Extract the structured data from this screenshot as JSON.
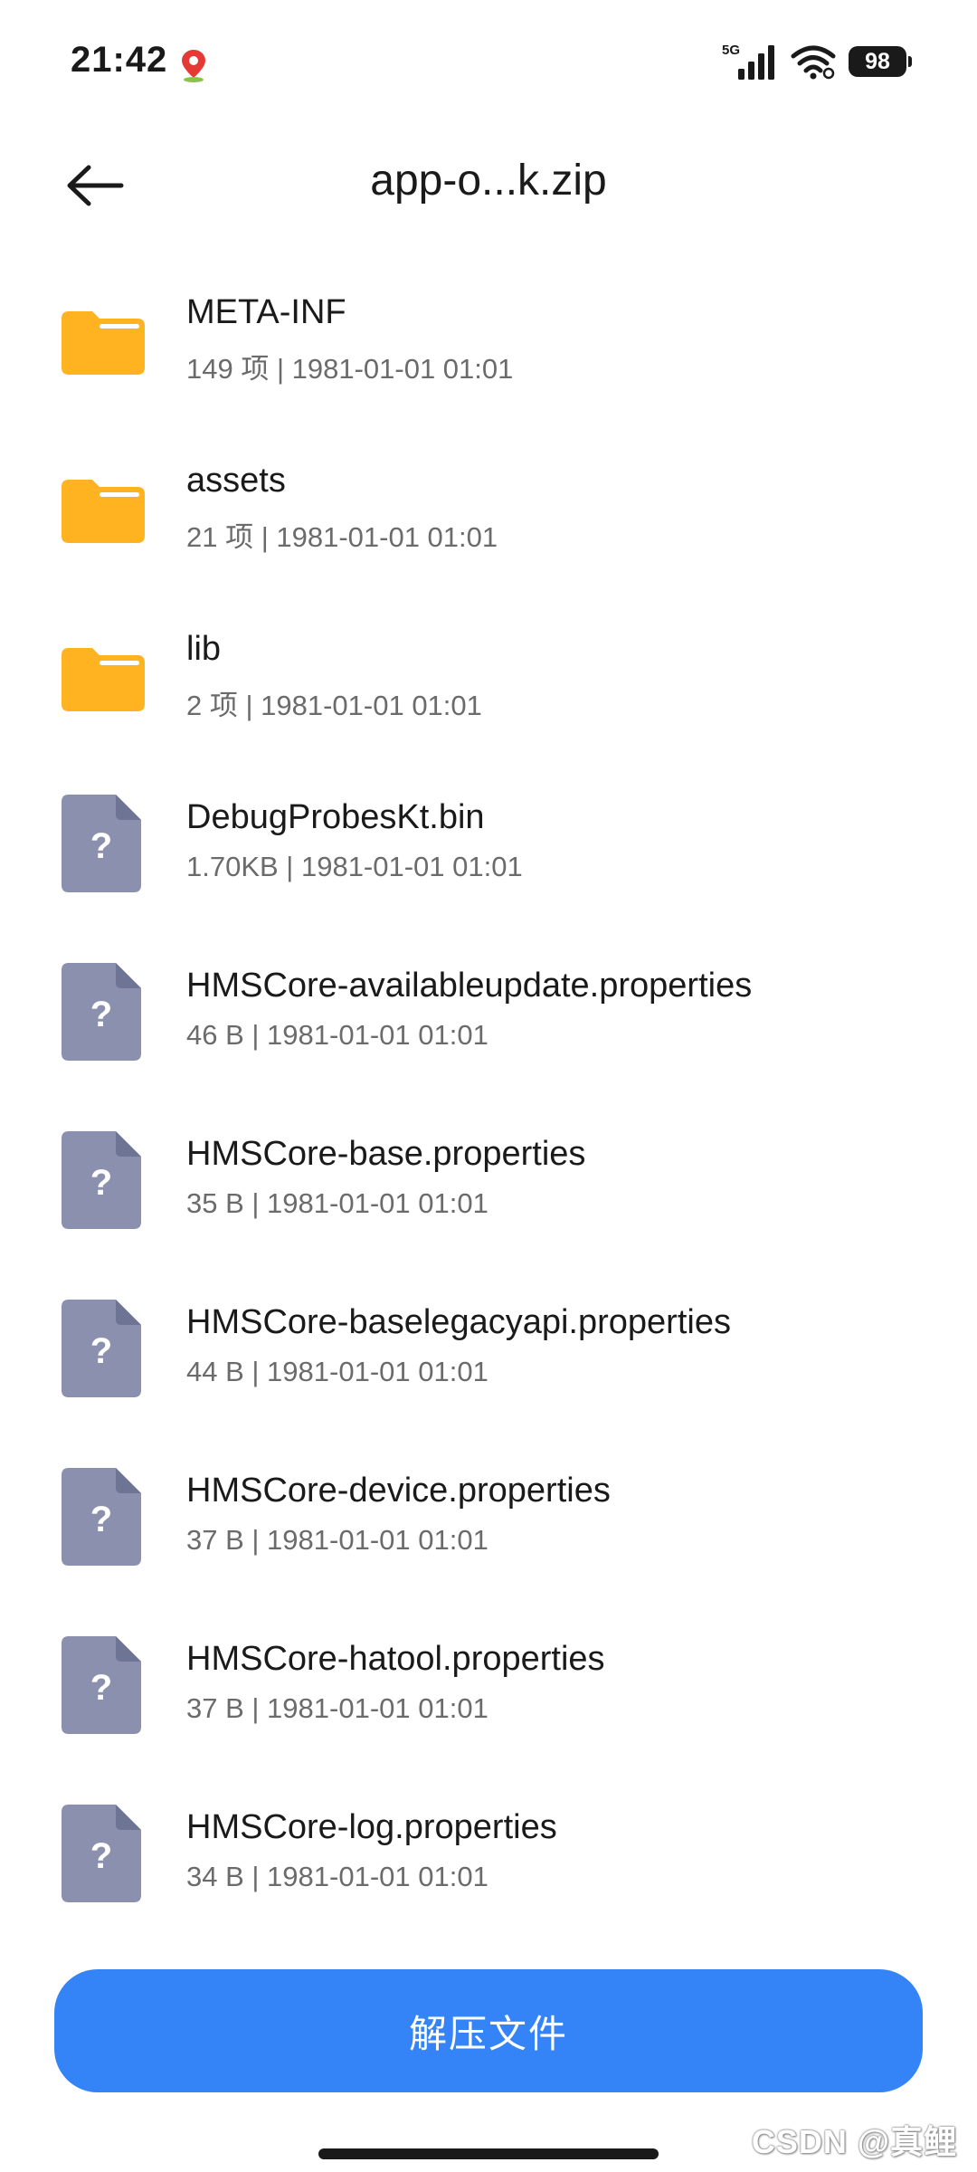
{
  "status_bar": {
    "time": "21:42",
    "network": "5G",
    "battery": "98"
  },
  "header": {
    "title": "app-o...k.zip"
  },
  "files": [
    {
      "name": "META-INF",
      "meta": "149 项 | 1981-01-01 01:01",
      "type": "folder"
    },
    {
      "name": "assets",
      "meta": "21 项 | 1981-01-01 01:01",
      "type": "folder"
    },
    {
      "name": "lib",
      "meta": "2 项 | 1981-01-01 01:01",
      "type": "folder"
    },
    {
      "name": "DebugProbesKt.bin",
      "meta": "1.70KB | 1981-01-01 01:01",
      "type": "unknown"
    },
    {
      "name": "HMSCore-availableupdate.properties",
      "meta": "46 B | 1981-01-01 01:01",
      "type": "unknown"
    },
    {
      "name": "HMSCore-base.properties",
      "meta": "35 B | 1981-01-01 01:01",
      "type": "unknown"
    },
    {
      "name": "HMSCore-baselegacyapi.properties",
      "meta": "44 B | 1981-01-01 01:01",
      "type": "unknown"
    },
    {
      "name": "HMSCore-device.properties",
      "meta": "37 B | 1981-01-01 01:01",
      "type": "unknown"
    },
    {
      "name": "HMSCore-hatool.properties",
      "meta": "37 B | 1981-01-01 01:01",
      "type": "unknown"
    },
    {
      "name": "HMSCore-log.properties",
      "meta": "34 B | 1981-01-01 01:01",
      "type": "unknown"
    }
  ],
  "actions": {
    "extract_label": "解压文件"
  },
  "watermark": "CSDN @真鲤",
  "colors": {
    "folder": "#ffb320",
    "unknown_file": "#8a90ad",
    "primary_button": "#3584f7"
  },
  "icons": {
    "back": "arrow-left-icon",
    "folder": "folder-icon",
    "unknown_file": "unknown-file-icon",
    "location": "location-pin-icon",
    "signal": "signal-icon",
    "wifi": "wifi-icon"
  }
}
